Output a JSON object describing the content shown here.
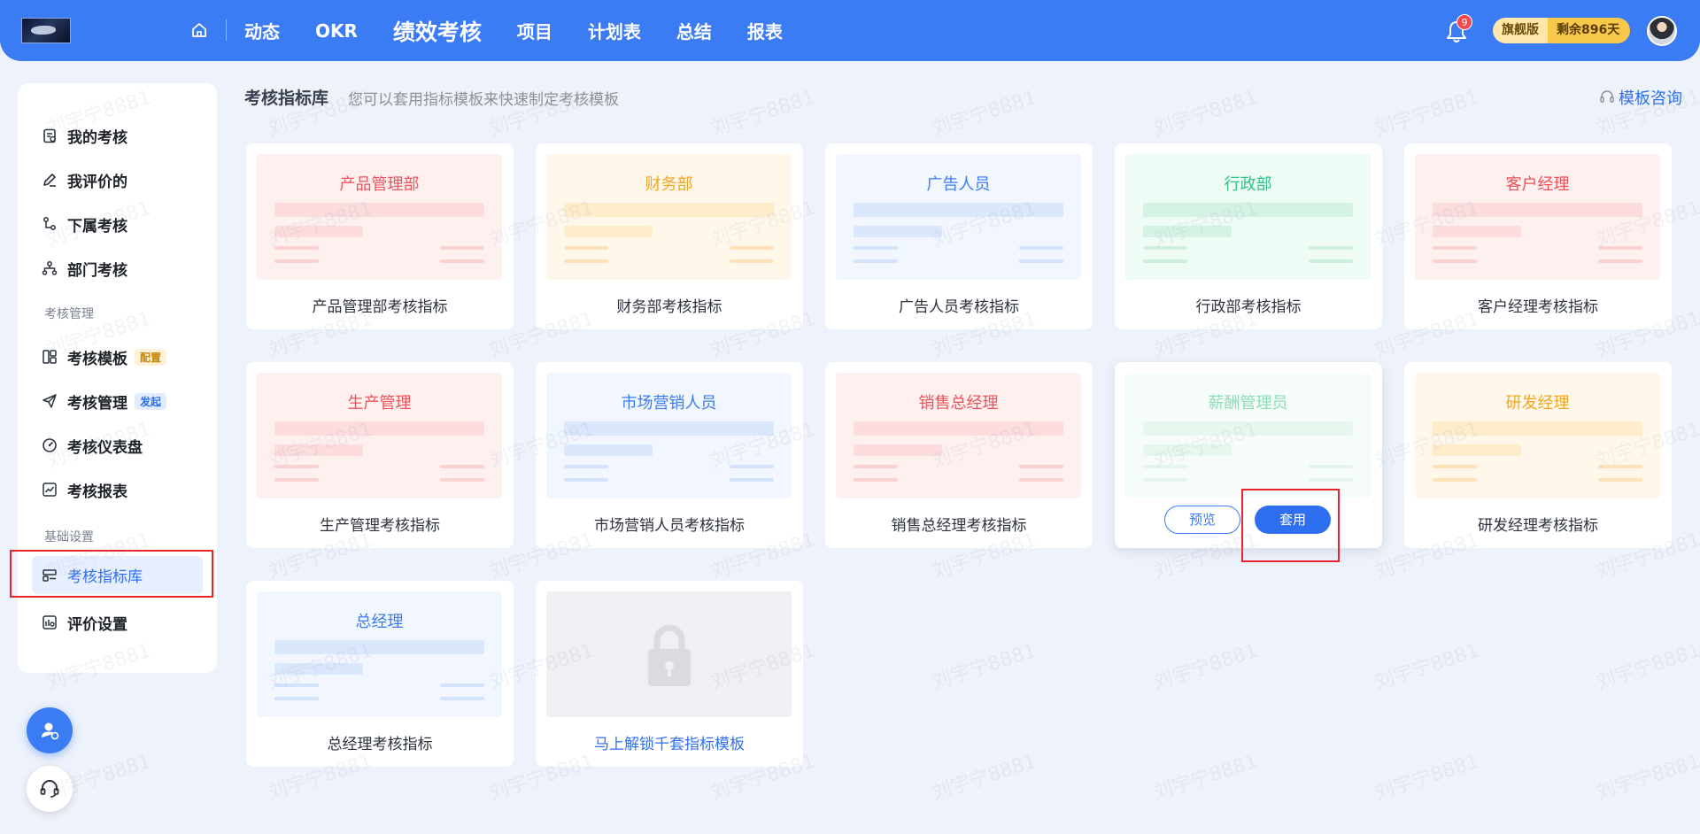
{
  "topbar": {
    "nav": [
      "动态",
      "OKR",
      "绩效考核",
      "项目",
      "计划表",
      "总结",
      "报表"
    ],
    "active_nav": "绩效考核",
    "notification_count": "9",
    "plan_name": "旗舰版",
    "plan_remaining": "剩余896天",
    "accent": "#3b7cf5"
  },
  "sidebar": {
    "items": [
      {
        "label": "我的考核",
        "icon": "clipboard-icon"
      },
      {
        "label": "我评价的",
        "icon": "pen-icon"
      },
      {
        "label": "下属考核",
        "icon": "subordinate-icon"
      },
      {
        "label": "部门考核",
        "icon": "org-icon"
      }
    ],
    "group1": "考核管理",
    "items2": [
      {
        "label": "考核模板",
        "tag": "配置",
        "icon": "template-icon"
      },
      {
        "label": "考核管理",
        "tag": "发起",
        "icon": "send-icon"
      },
      {
        "label": "考核仪表盘",
        "icon": "gauge-icon"
      },
      {
        "label": "考核报表",
        "icon": "chart-icon"
      }
    ],
    "group2": "基础设置",
    "items3": [
      {
        "label": "考核指标库",
        "icon": "library-icon",
        "active": true
      },
      {
        "label": "评价设置",
        "icon": "settings-icon"
      }
    ]
  },
  "content": {
    "title": "考核指标库",
    "subtitle": "您可以套用指标模板来快速制定考核模板",
    "consult": "模板咨询",
    "cards": [
      {
        "thumb_title": "产品管理部",
        "label": "产品管理部考核指标",
        "theme": "red"
      },
      {
        "thumb_title": "财务部",
        "label": "财务部考核指标",
        "theme": "yellow"
      },
      {
        "thumb_title": "广告人员",
        "label": "广告人员考核指标",
        "theme": "blue"
      },
      {
        "thumb_title": "行政部",
        "label": "行政部考核指标",
        "theme": "green"
      },
      {
        "thumb_title": "客户经理",
        "label": "客户经理考核指标",
        "theme": "red"
      },
      {
        "thumb_title": "生产管理",
        "label": "生产管理考核指标",
        "theme": "red"
      },
      {
        "thumb_title": "市场营销人员",
        "label": "市场营销人员考核指标",
        "theme": "blue"
      },
      {
        "thumb_title": "销售总经理",
        "label": "销售总经理考核指标",
        "theme": "red"
      },
      {
        "thumb_title": "薪酬管理员",
        "label": "",
        "theme": "green-dim",
        "hover": true
      },
      {
        "thumb_title": "研发经理",
        "label": "研发经理考核指标",
        "theme": "yellow"
      },
      {
        "thumb_title": "总经理",
        "label": "总经理考核指标",
        "theme": "blue"
      },
      {
        "thumb_title": "",
        "label": "马上解锁千套指标模板",
        "theme": "lock"
      }
    ],
    "preview_label": "预览",
    "apply_label": "套用"
  },
  "watermark": "刘宇宁8881"
}
